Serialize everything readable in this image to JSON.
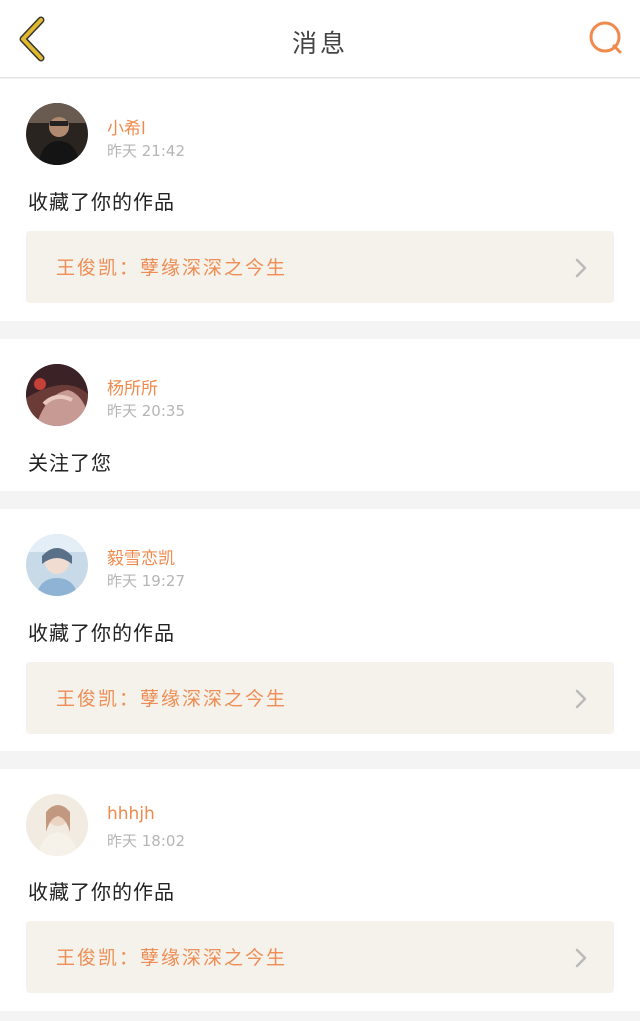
{
  "header": {
    "title": "消息"
  },
  "colors": {
    "accent": "#ef8a4c",
    "back_icon": "#e0b92e",
    "work_bg": "#f4f2ea"
  },
  "messages": [
    {
      "username": "小希l",
      "time": "昨天 21:42",
      "action": "收藏了你的作品",
      "work_title": "王俊凯：孽缘深深之今生"
    },
    {
      "username": "杨所所",
      "time": "昨天 20:35",
      "action": "关注了您"
    },
    {
      "username": "毅雪恋凯",
      "time": "昨天 19:27",
      "action": "收藏了你的作品",
      "work_title": "王俊凯：孽缘深深之今生"
    },
    {
      "username": "hhhjh",
      "time": "昨天 18:02",
      "action": "收藏了你的作品",
      "work_title": "王俊凯：孽缘深深之今生"
    }
  ]
}
